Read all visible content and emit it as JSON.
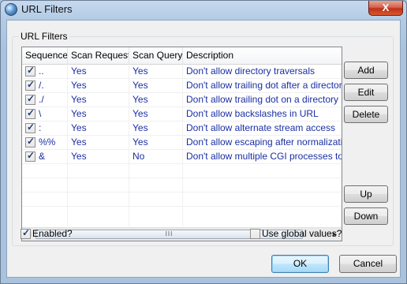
{
  "window": {
    "title": "URL Filters",
    "close_glyph": "X"
  },
  "group": {
    "title": "URL Filters"
  },
  "list": {
    "columns": [
      "Sequence",
      "Scan Request",
      "Scan Query",
      "Description"
    ],
    "rows": [
      {
        "checked": true,
        "sequence": "..",
        "scan_request": "Yes",
        "scan_query": "Yes",
        "description": "Don't allow directory traversals"
      },
      {
        "checked": true,
        "sequence": "/.",
        "scan_request": "Yes",
        "scan_query": "Yes",
        "description": "Don't allow trailing dot after a directory"
      },
      {
        "checked": true,
        "sequence": "./",
        "scan_request": "Yes",
        "scan_query": "Yes",
        "description": "Don't allow trailing dot on a directory na"
      },
      {
        "checked": true,
        "sequence": "\\",
        "scan_request": "Yes",
        "scan_query": "Yes",
        "description": "Don't allow backslashes in URL"
      },
      {
        "checked": true,
        "sequence": ":",
        "scan_request": "Yes",
        "scan_query": "Yes",
        "description": "Don't allow alternate stream access"
      },
      {
        "checked": true,
        "sequence": "%%",
        "scan_request": "Yes",
        "scan_query": "Yes",
        "description": "Don't allow escaping after normalization"
      },
      {
        "checked": true,
        "sequence": "&",
        "scan_request": "Yes",
        "scan_query": "No",
        "description": "Don't allow multiple CGI processes to rur"
      }
    ],
    "scrollbar": {
      "left_arrow": "◀",
      "right_arrow": "▶",
      "grip": "III"
    }
  },
  "buttons": {
    "add": "Add",
    "edit": "Edit",
    "delete": "Delete",
    "up": "Up",
    "down": "Down",
    "ok": "OK",
    "cancel": "Cancel"
  },
  "options": {
    "enabled_label": "Enabled?",
    "enabled_checked": true,
    "global_label": "Use global values?",
    "global_checked": false
  }
}
